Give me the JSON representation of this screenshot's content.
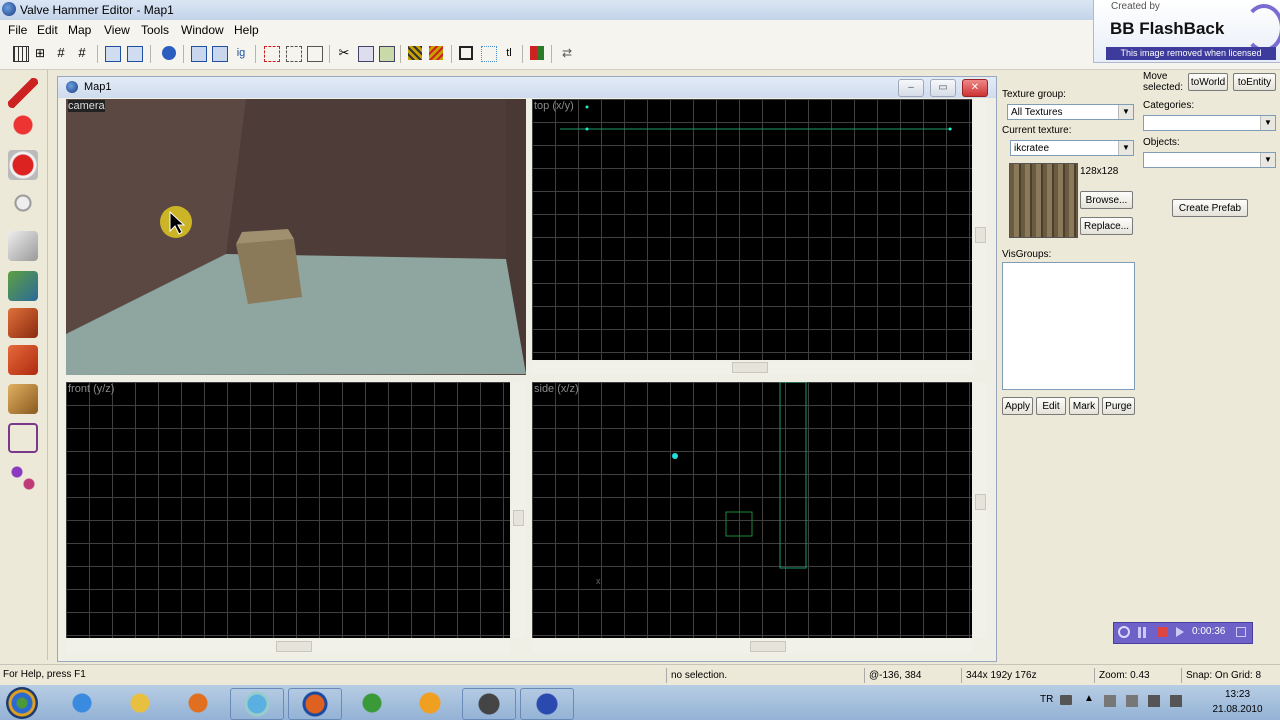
{
  "window": {
    "title": "Valve Hammer Editor - Map1"
  },
  "menu": [
    "File",
    "Edit",
    "Map",
    "View",
    "Tools",
    "Window",
    "Help"
  ],
  "badge": {
    "created_by": "Created by",
    "name": "BB FlashBack",
    "notice": "This image removed when licensed"
  },
  "mdi": {
    "title": "Map1"
  },
  "viewports": {
    "camera": "camera",
    "top": "top (x/y)",
    "front": "front (y/z)",
    "side": "side (x/z)"
  },
  "panel": {
    "texture_group_label": "Texture group:",
    "texture_group_value": "All Textures",
    "current_texture_label": "Current texture:",
    "current_texture_value": "ikcratee",
    "texture_size": "128x128",
    "browse": "Browse...",
    "replace": "Replace...",
    "visgroups_label": "VisGroups:",
    "apply": "Apply",
    "edit": "Edit",
    "mark": "Mark",
    "purge": "Purge"
  },
  "farright": {
    "move_selected": "Move selected:",
    "to_world": "toWorld",
    "to_entity": "toEntity",
    "categories_label": "Categories:",
    "objects_label": "Objects:",
    "create_prefab": "Create Prefab"
  },
  "status": {
    "help": "For Help, press F1",
    "selection": "no selection.",
    "coords": "@-136, 384",
    "size": "344x 192y 176z",
    "zoom": "Zoom: 0.43",
    "snap": "Snap: On Grid: 8"
  },
  "recorder": {
    "time": "0:00:36"
  },
  "taskbar": {
    "lang": "TR",
    "time": "13:23",
    "date": "21.08.2010"
  },
  "colors": {
    "accent": "#6e62c8",
    "viewport_bg": "#000000",
    "grid": "#3f3f3f"
  }
}
